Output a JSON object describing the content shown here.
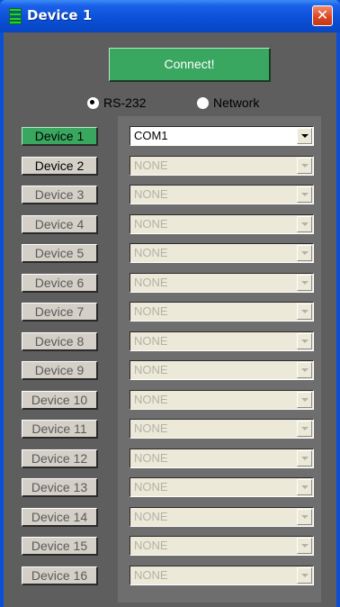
{
  "window": {
    "title": "Device 1",
    "close_glyph": "✕",
    "title_icon": "green-bars-icon"
  },
  "connect": {
    "label": "Connect!"
  },
  "connection_type": {
    "options": [
      {
        "label": "RS-232",
        "selected": true
      },
      {
        "label": "Network",
        "selected": false
      }
    ]
  },
  "devices": [
    {
      "label": "Device 1",
      "port": "COM1",
      "state": "active",
      "port_enabled": true
    },
    {
      "label": "Device 2",
      "port": "NONE",
      "state": "enabled",
      "port_enabled": false
    },
    {
      "label": "Device 3",
      "port": "NONE",
      "state": "disabled",
      "port_enabled": false
    },
    {
      "label": "Device 4",
      "port": "NONE",
      "state": "disabled",
      "port_enabled": false
    },
    {
      "label": "Device 5",
      "port": "NONE",
      "state": "disabled",
      "port_enabled": false
    },
    {
      "label": "Device 6",
      "port": "NONE",
      "state": "disabled",
      "port_enabled": false
    },
    {
      "label": "Device 7",
      "port": "NONE",
      "state": "disabled",
      "port_enabled": false
    },
    {
      "label": "Device 8",
      "port": "NONE",
      "state": "disabled",
      "port_enabled": false
    },
    {
      "label": "Device 9",
      "port": "NONE",
      "state": "disabled",
      "port_enabled": false
    },
    {
      "label": "Device 10",
      "port": "NONE",
      "state": "disabled",
      "port_enabled": false
    },
    {
      "label": "Device 11",
      "port": "NONE",
      "state": "disabled",
      "port_enabled": false
    },
    {
      "label": "Device 12",
      "port": "NONE",
      "state": "disabled",
      "port_enabled": false
    },
    {
      "label": "Device 13",
      "port": "NONE",
      "state": "disabled",
      "port_enabled": false
    },
    {
      "label": "Device 14",
      "port": "NONE",
      "state": "disabled",
      "port_enabled": false
    },
    {
      "label": "Device 15",
      "port": "NONE",
      "state": "disabled",
      "port_enabled": false
    },
    {
      "label": "Device 16",
      "port": "NONE",
      "state": "disabled",
      "port_enabled": false
    }
  ],
  "colors": {
    "titlebar": "#0a4fd6",
    "client_bg": "#5e5e5e",
    "panel_bg": "#6e6e6e",
    "accent_green": "#3aa760",
    "close_red": "#d9441f"
  }
}
